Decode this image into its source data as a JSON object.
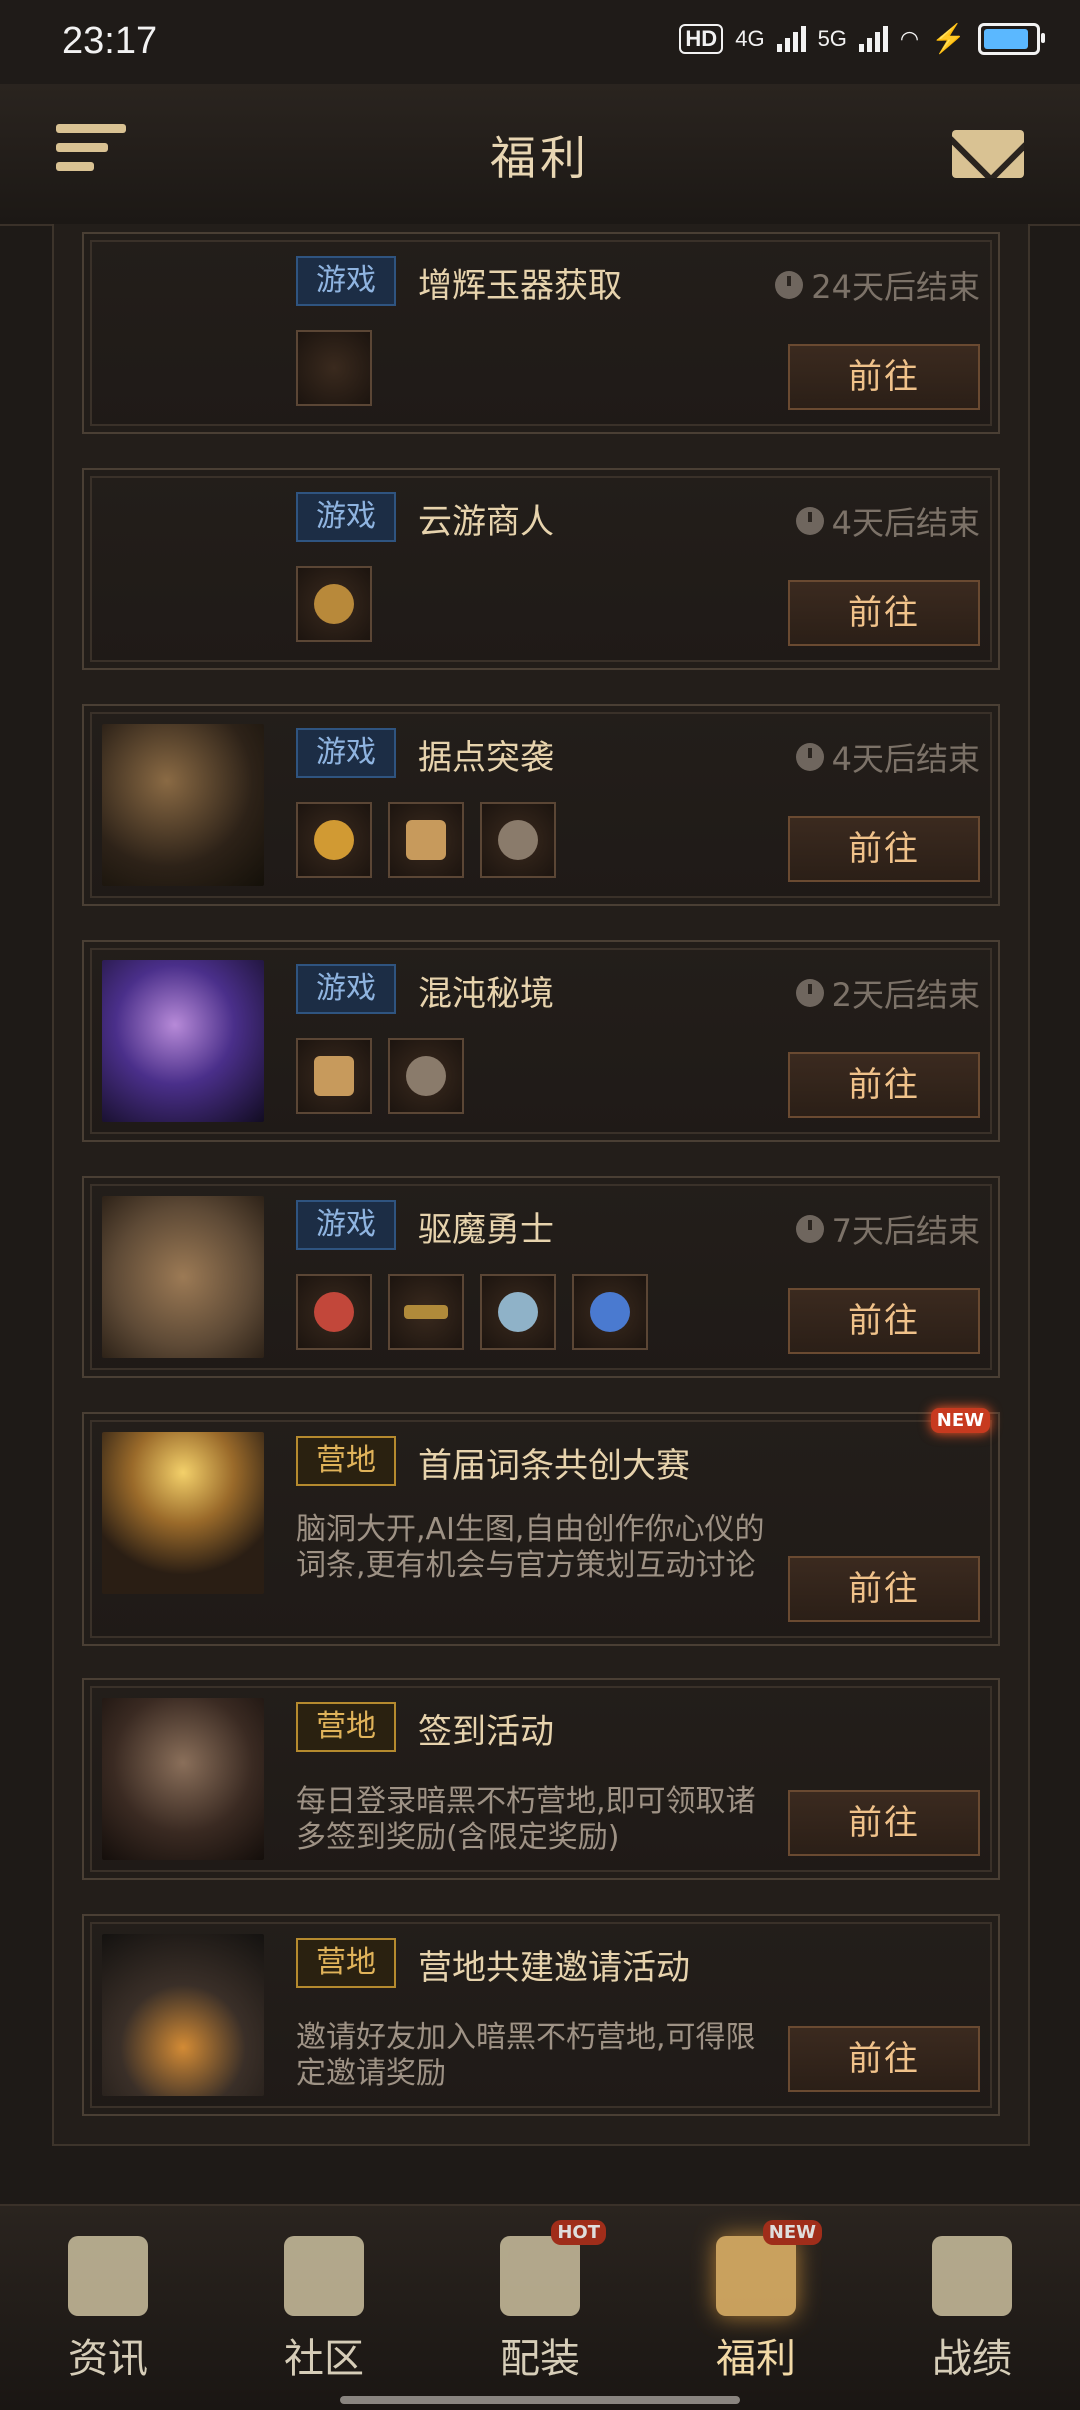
{
  "status_bar": {
    "time": "23:17",
    "hd": "HD",
    "net1": "4G",
    "net2": "5G"
  },
  "header": {
    "title": "福利",
    "menu_icon": "menu-icon",
    "mail_icon": "mail-icon"
  },
  "cards": [
    {
      "tag": "游戏",
      "title": "增辉玉器获取",
      "timer": "24天后结束",
      "goto": "前往"
    },
    {
      "tag": "游戏",
      "title": "云游商人",
      "timer": "4天后结束",
      "goto": "前往"
    },
    {
      "tag": "游戏",
      "title": "据点突袭",
      "timer": "4天后结束",
      "goto": "前往"
    },
    {
      "tag": "游戏",
      "title": "混沌秘境",
      "timer": "2天后结束",
      "goto": "前往"
    },
    {
      "tag": "游戏",
      "title": "驱魔勇士",
      "timer": "7天后结束",
      "goto": "前往"
    },
    {
      "tag": "营地",
      "title": "首届词条共创大赛",
      "desc": "脑洞大开,AI生图,自由创作你心仪的词条,更有机会与官方策划互动讨论",
      "goto": "前往",
      "badge": "NEW"
    },
    {
      "tag": "营地",
      "title": "签到活动",
      "desc": "每日登录暗黑不朽营地,即可领取诸多签到奖励(含限定奖励)",
      "goto": "前往"
    },
    {
      "tag": "营地",
      "title": "营地共建邀请活动",
      "desc": "邀请好友加入暗黑不朽营地,可得限定邀请奖励",
      "goto": "前往"
    }
  ],
  "tabs": [
    {
      "label": "资讯",
      "icon": "scroll-icon"
    },
    {
      "label": "社区",
      "icon": "campfire-icon"
    },
    {
      "label": "配装",
      "icon": "helmet-icon",
      "badge": "HOT"
    },
    {
      "label": "福利",
      "icon": "chest-icon",
      "badge": "NEW",
      "active": true
    },
    {
      "label": "战绩",
      "icon": "crossed-swords-icon"
    }
  ],
  "colors": {
    "background": "#1e1a17",
    "game_tag": "#1c2d45",
    "camp_tag": "#2a2110",
    "accent": "#f0c28a"
  }
}
